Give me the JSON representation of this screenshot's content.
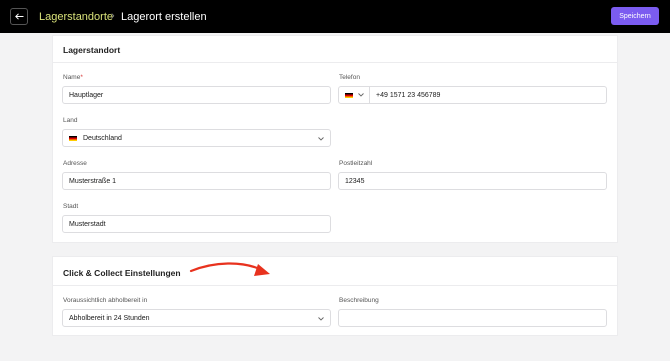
{
  "header": {
    "breadcrumb_parent": "Lagerstandorte",
    "breadcrumb_separator": "›",
    "title": "Lagerort erstellen",
    "save_label": "Speichern"
  },
  "location": {
    "section_title": "Lagerstandort",
    "name": {
      "label": "Name",
      "required_mark": "*",
      "value": "Hauptlager"
    },
    "phone": {
      "label": "Telefon",
      "country_flag": "de-flag-icon",
      "value": "+49 1571 23 456789"
    },
    "country": {
      "label": "Land",
      "value": "Deutschland"
    },
    "address": {
      "label": "Adresse",
      "value": "Musterstraße 1"
    },
    "postal": {
      "label": "Postleitzahl",
      "value": "12345"
    },
    "city": {
      "label": "Stadt",
      "value": "Musterstadt"
    }
  },
  "click_collect": {
    "section_title": "Click & Collect Einstellungen",
    "ready": {
      "label": "Voraussichtlich abholbereit in",
      "value": "Abholbereit in 24 Stunden"
    },
    "description": {
      "label": "Beschreibung",
      "value": ""
    }
  },
  "colors": {
    "accent": "#7b5cf0",
    "breadcrumb": "#d9e27a",
    "annotation_arrow": "#e8321e"
  }
}
